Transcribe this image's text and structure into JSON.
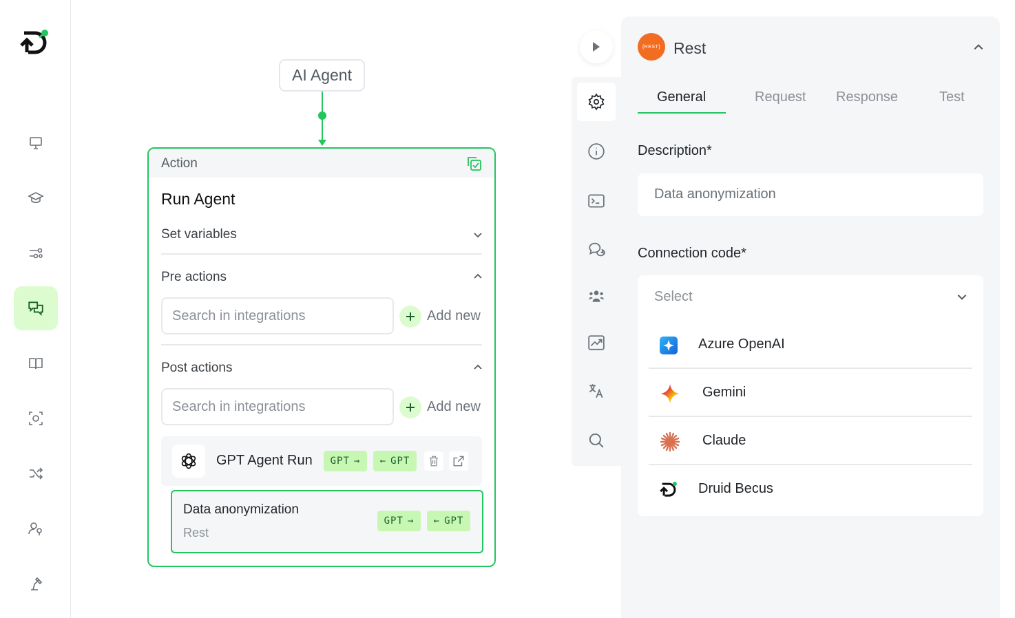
{
  "canvas": {
    "agent_node_label": "AI Agent",
    "action_card": {
      "header": "Action",
      "title": "Run Agent",
      "set_variables_label": "Set variables",
      "pre_actions": {
        "label": "Pre actions",
        "search_placeholder": "Search in integrations",
        "add_label": "Add new"
      },
      "post_actions": {
        "label": "Post actions",
        "search_placeholder": "Search in integrations",
        "add_label": "Add new"
      },
      "gpt_row": {
        "title": "GPT Agent Run",
        "tag_out": "GPT",
        "tag_in": "GPT"
      },
      "data_card": {
        "title": "Data anonymization",
        "subtitle": "Rest",
        "tag_out": "GPT",
        "tag_in": "GPT"
      }
    }
  },
  "panel": {
    "badge_text": "{REST}",
    "title": "Rest",
    "tabs": [
      "General",
      "Request",
      "Response",
      "Test"
    ],
    "active_tab": "General",
    "description_label": "Description*",
    "description_value": "Data anonymization",
    "connection_label": "Connection code*",
    "connection_select_placeholder": "Select",
    "connection_options": [
      {
        "label": "Azure OpenAI",
        "icon": "azure-openai-icon"
      },
      {
        "label": "Gemini",
        "icon": "gemini-icon"
      },
      {
        "label": "Claude",
        "icon": "claude-icon"
      },
      {
        "label": "Druid Becus",
        "icon": "druid-icon"
      }
    ]
  },
  "colors": {
    "accent": "#22c55e",
    "accent_light": "#dcfccf",
    "rest_badge": "#f26d21",
    "panel_bg": "#f4f6f8"
  }
}
